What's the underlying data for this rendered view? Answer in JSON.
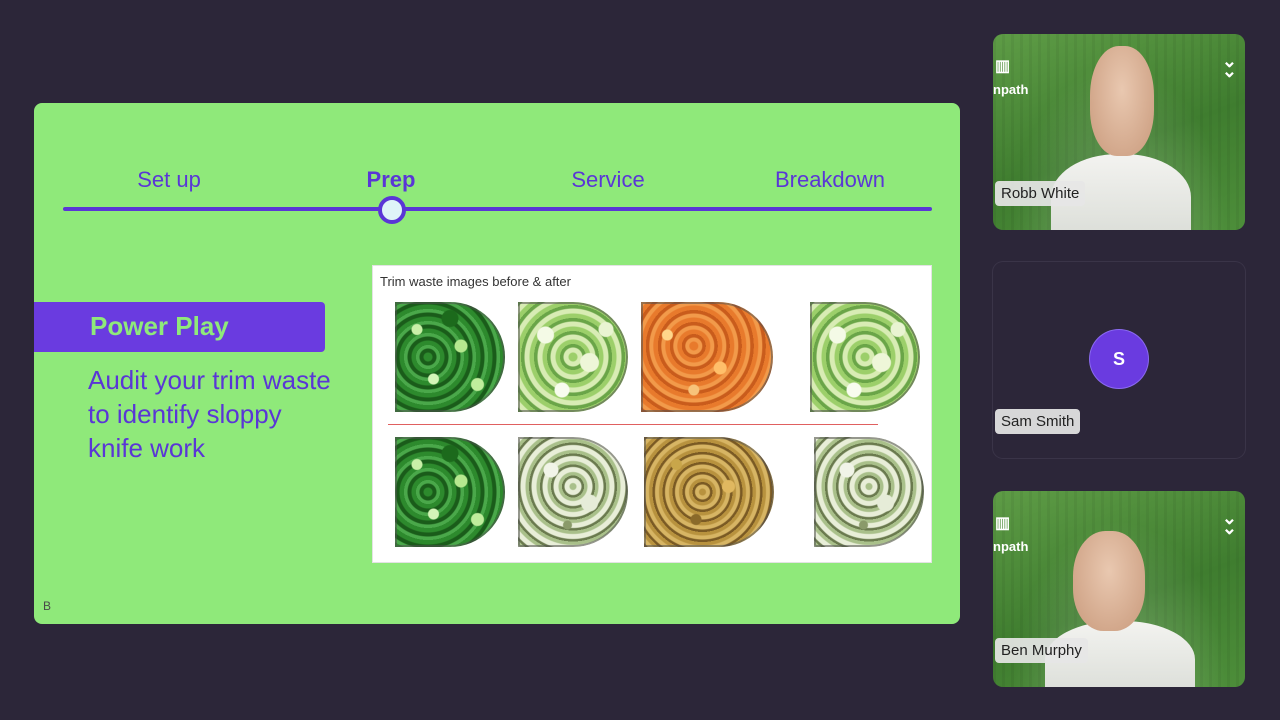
{
  "slide": {
    "stages": [
      "Set up",
      "Prep",
      "Service",
      "Breakdown"
    ],
    "active_stage": "Prep",
    "power_play_title": "Power Play",
    "power_play_text": "Audit your trim waste to identify sloppy knife work",
    "trim_caption": "Trim waste images before & after",
    "footer": "B",
    "colors": {
      "background": "#8fe97a",
      "accent": "#5a36d6",
      "banner": "#6a3be0"
    }
  },
  "participants": [
    {
      "name": "Robb White",
      "video": true,
      "brand": "npath"
    },
    {
      "name": "Sam Smith",
      "video": false,
      "initial": "S"
    },
    {
      "name": "Ben Murphy",
      "video": true,
      "brand": "npath"
    }
  ]
}
